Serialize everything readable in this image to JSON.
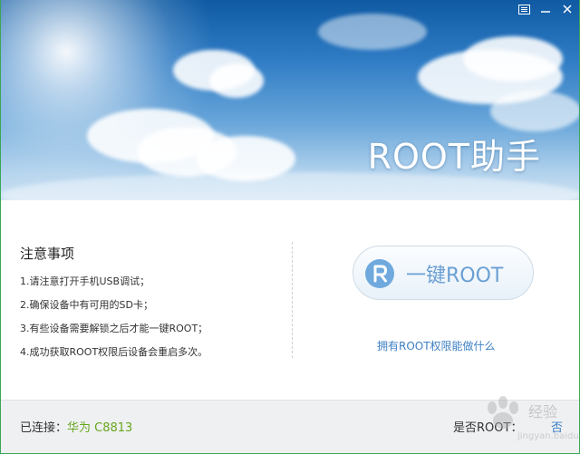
{
  "app": {
    "title": "ROOT助手"
  },
  "window_controls": {
    "icons": [
      "menu-icon",
      "minimize-icon",
      "close-icon"
    ]
  },
  "notice": {
    "title": "注意事项",
    "items": [
      "1.请注意打开手机USB调试；",
      "2.确保设备中有可用的SD卡；",
      "3.有些设备需要解锁之后才能一键ROOT；",
      "4.成功获取ROOT权限后设备会重启多次。"
    ]
  },
  "action": {
    "root_button_label": "一键ROOT",
    "root_icon_letter": "R",
    "info_link": "拥有ROOT权限能做什么"
  },
  "status": {
    "connected_label": "已连接：",
    "device_name": "华为 C8813",
    "root_label": "是否ROOT：",
    "root_value": "否"
  },
  "watermark": {
    "text": "Bai经验"
  },
  "colors": {
    "accent_green": "#68a71e",
    "link_blue": "#3d7fc4",
    "button_text": "#6a9fd3",
    "window_border": "#3aa655"
  }
}
